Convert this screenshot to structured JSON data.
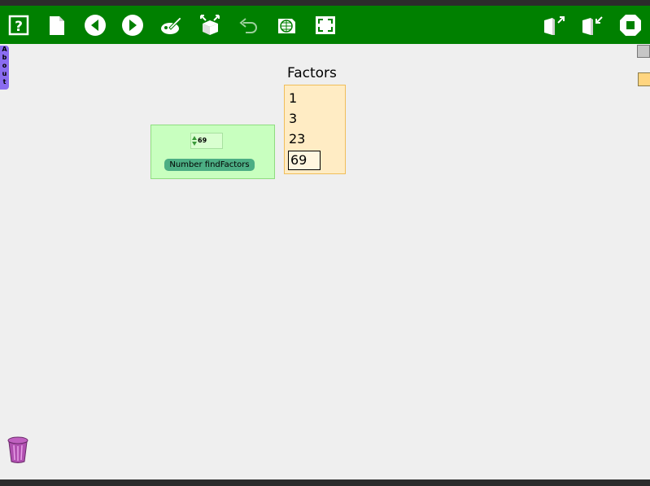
{
  "toolbar": {
    "buttons": [
      {
        "name": "help",
        "icon": "help-icon"
      },
      {
        "name": "new-page",
        "icon": "page-icon"
      },
      {
        "name": "previous",
        "icon": "back-arrow-icon"
      },
      {
        "name": "next",
        "icon": "forward-arrow-icon"
      },
      {
        "name": "paint",
        "icon": "paint-icon"
      },
      {
        "name": "toolbox",
        "icon": "box-icon"
      },
      {
        "name": "undo",
        "icon": "undo-icon"
      },
      {
        "name": "publish",
        "icon": "globe-icon"
      },
      {
        "name": "fullscreen",
        "icon": "fullscreen-icon"
      },
      {
        "name": "share",
        "icon": "share-icon"
      },
      {
        "name": "unshare",
        "icon": "unshare-icon"
      },
      {
        "name": "stop",
        "icon": "stop-icon"
      }
    ],
    "colors": {
      "bar": "#008000",
      "icon": "#ffffff"
    }
  },
  "about_tab": {
    "label": "About"
  },
  "number_panel": {
    "value": "69",
    "button_label": "Number findFactors"
  },
  "factors": {
    "title": "Factors",
    "values": [
      "1",
      "3",
      "23",
      "69"
    ],
    "selected_index": 3
  },
  "trash": {
    "icon": "trash-icon"
  }
}
